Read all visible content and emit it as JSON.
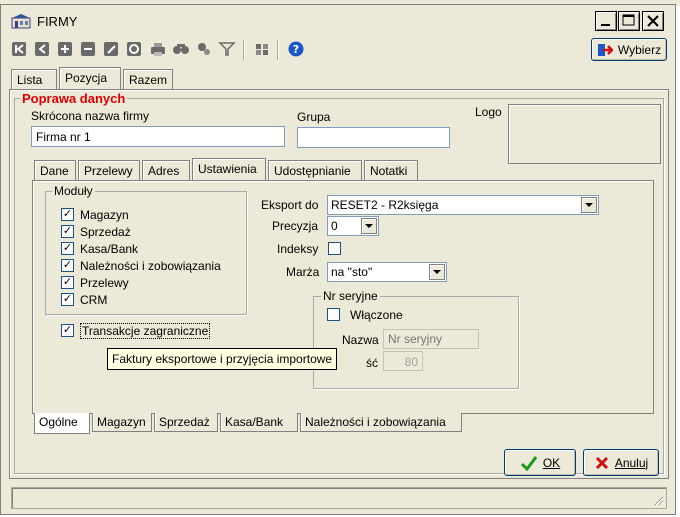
{
  "window": {
    "title": "FIRMY",
    "colors": {
      "face": "#ece9d8",
      "heading_red": "#e00000",
      "ok_green": "#1a9a1a",
      "cancel_red": "#cc1010",
      "help_blue": "#1a56c8"
    }
  },
  "toolbar": {
    "icons": [
      "first-record-icon",
      "prev-record-icon",
      "add-record-icon",
      "delete-record-icon",
      "edit-record-icon",
      "refresh-icon",
      "print-icon",
      "find-icon",
      "tools-icon",
      "filter-icon",
      "settings-icon",
      "help-icon"
    ],
    "select_label": "Wybierz"
  },
  "main_tabs": [
    "Lista",
    "Pozycja",
    "Razem"
  ],
  "main_tab_active": "Pozycja",
  "section": {
    "heading": "Poprawa danych"
  },
  "fields": {
    "short_name_label": "Skrócona nazwa firmy",
    "short_name_value": "Firma nr 1",
    "group_label": "Grupa",
    "group_value": "",
    "logo_label": "Logo"
  },
  "inner_tabs": [
    "Dane",
    "Przelewy",
    "Adres",
    "Ustawienia",
    "Udostępnianie",
    "Notatki"
  ],
  "inner_tab_active": "Ustawienia",
  "modules": {
    "title": "Moduły",
    "items": [
      {
        "label": "Magazyn",
        "checked": "✓"
      },
      {
        "label": "Sprzedaż",
        "checked": "✓"
      },
      {
        "label": "Kasa/Bank",
        "checked": "✓"
      },
      {
        "label": "Należności i zobowiązania",
        "checked": "✓"
      },
      {
        "label": "Przelewy",
        "checked": "✓"
      },
      {
        "label": "CRM",
        "checked": "✓"
      }
    ]
  },
  "transakcje": {
    "label": "Transakcje zagraniczne",
    "checked": "✓"
  },
  "settings": {
    "export_label": "Eksport do",
    "export_value": "RESET2 - R2księga",
    "precision_label": "Precyzja",
    "precision_value": "0",
    "indexes_label": "Indeksy",
    "margin_label": "Marża",
    "margin_value": "na \"sto\""
  },
  "serial": {
    "title": "Nr seryjne",
    "enabled_label": "Włączone",
    "name_label": "Nazwa",
    "name_placeholder": "Nr seryjny",
    "length_label_tail": "ść",
    "length_value": "80"
  },
  "tooltip": "Faktury eksportowe i przyjęcia importowe",
  "bottom_tabs": [
    "Ogólne",
    "Magazyn",
    "Sprzedaż",
    "Kasa/Bank",
    "Należności i zobowiązania"
  ],
  "bottom_tab_active": "Ogólne",
  "buttons": {
    "ok": "OK",
    "cancel": "Anuluj"
  },
  "status": ""
}
